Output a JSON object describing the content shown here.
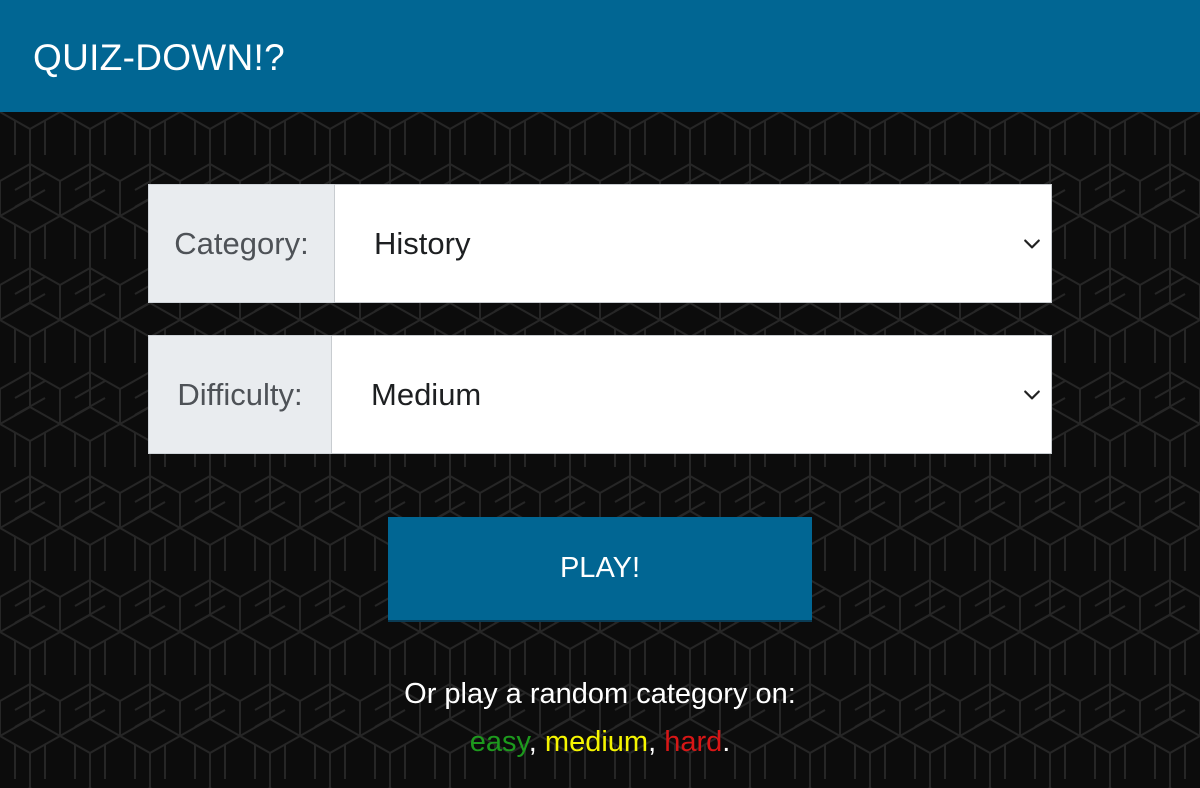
{
  "app": {
    "title": "QUIZ-DOWN!?"
  },
  "colors": {
    "header": "#016693",
    "background": "#0c0c0c",
    "easy": "#1d9a1d",
    "medium": "#f5f500",
    "hard": "#d81616"
  },
  "form": {
    "category": {
      "label": "Category:",
      "selected": "History"
    },
    "difficulty": {
      "label": "Difficulty:",
      "selected": "Medium"
    }
  },
  "play": {
    "label": "PLAY!"
  },
  "random": {
    "intro": "Or play a random category on:",
    "easy": "easy",
    "sep1": ",",
    "medium": "medium",
    "sep2": ",",
    "hard": "hard",
    "end": "."
  }
}
